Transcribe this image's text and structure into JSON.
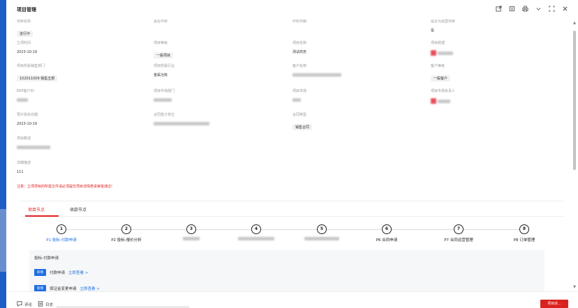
{
  "window": {
    "title": "项目管理"
  },
  "toolbar_icons": [
    "external-link-icon",
    "copy-icon",
    "print-icon",
    "chevron-down-icon",
    "fullscreen-icon",
    "close-icon"
  ],
  "fields": {
    "status": {
      "label": "项目状态",
      "value": "进行中"
    },
    "col2_row0": {
      "label": "是否中标",
      "value": ""
    },
    "col3_row0": {
      "label": "中标日期",
      "value": ""
    },
    "col4_row0": {
      "label": "是否为运营项目",
      "value": "是"
    },
    "created": {
      "label": "立项时间",
      "value": "2023-10-19"
    },
    "grade": {
      "label": "项目等级",
      "value": "一般项目"
    },
    "name": {
      "label": "项目名称",
      "value": "测试商务"
    },
    "manager": {
      "label": "项目经理",
      "value": ""
    },
    "dept": {
      "label": "项目所属销售部门",
      "value": "102011009 销售五部"
    },
    "industry": {
      "label": "项目所属行业",
      "value": "金属冶炼"
    },
    "customer": {
      "label": "客户名称",
      "value": ""
    },
    "customer_level": {
      "label": "客户等级",
      "value": "一般客户"
    },
    "erp": {
      "label": "ERP客户ID",
      "value": ""
    },
    "market_dept": {
      "label": "项目市场部门",
      "value": ""
    },
    "market": {
      "label": "项目市场",
      "value": ""
    },
    "market_owner": {
      "label": "项目市场负责人",
      "value": ""
    },
    "bid_date": {
      "label": "预计投标日期",
      "value": "2023-10-19"
    },
    "contract_org": {
      "label": "合同签订单位",
      "value": ""
    },
    "contract_type": {
      "label": "合同类型",
      "value": "销售合同"
    },
    "summary": {
      "label": "项目概述",
      "value": ""
    },
    "detail": {
      "label": "详细描述",
      "value": "111"
    }
  },
  "notice": "注意：立项项目的所需文件请必须提交项目详情表进审批通过!",
  "tabs": [
    {
      "label": "项目节点"
    },
    {
      "label": "收款节点"
    }
  ],
  "steps": [
    {
      "num": "1",
      "label": "P1 投标-付款申请"
    },
    {
      "num": "2",
      "label": "P2 投标-报价分析"
    },
    {
      "num": "3",
      "label": ""
    },
    {
      "num": "4",
      "label": ""
    },
    {
      "num": "5",
      "label": ""
    },
    {
      "num": "6",
      "label": "P6 合同申请"
    },
    {
      "num": "7",
      "label": "P7 合同运营管理"
    },
    {
      "num": "8",
      "label": "P8 订单管理"
    }
  ],
  "subpanel": {
    "title": "投标-付款申请",
    "rows": [
      {
        "badge": "新增",
        "text": "付款申请",
        "link": "立即查看 >"
      },
      {
        "badge": "新增",
        "text": "保证金变更申请",
        "link": "立即查看 >"
      }
    ]
  },
  "bottom": {
    "comment": "评论",
    "log": "日志",
    "action": "项目状..."
  },
  "colors": {
    "accent": "#e02020",
    "primary": "#1e6fe0",
    "side": "#1d5fc9"
  }
}
